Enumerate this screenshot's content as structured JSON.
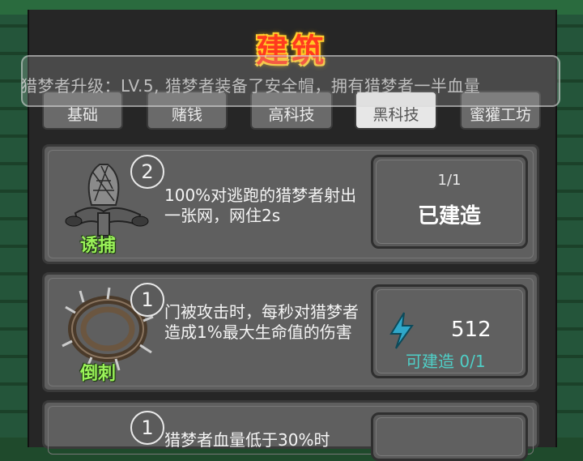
{
  "header": {
    "title": "建筑"
  },
  "tabs": [
    {
      "label": "基础",
      "active": false
    },
    {
      "label": "赌钱",
      "active": false
    },
    {
      "label": "高科技",
      "active": false
    },
    {
      "label": "黑科技",
      "active": true
    },
    {
      "label": "蜜獾工坊",
      "active": false
    }
  ],
  "toast": {
    "text": "猎梦者升级：LV.5, 猎梦者装备了安全帽，拥有猎梦者一半血量"
  },
  "buildings": [
    {
      "name": "诱捕",
      "level": "2",
      "description": "100%对逃跑的猎梦者射出一张网，网住2s",
      "count": "1/1",
      "status": "已建造"
    },
    {
      "name": "倒刺",
      "level": "1",
      "description": "门被攻击时，每秒对猎梦者造成1%最大生命值的伤害",
      "cost": "512",
      "available": "可建造 0/1"
    },
    {
      "level": "1",
      "description": "猎梦者血量低于30%时"
    }
  ],
  "colors": {
    "title": "#ff3a1e",
    "name": "#9bf25a",
    "available": "#4fcfc7",
    "bolt": "#2fa7c9"
  }
}
